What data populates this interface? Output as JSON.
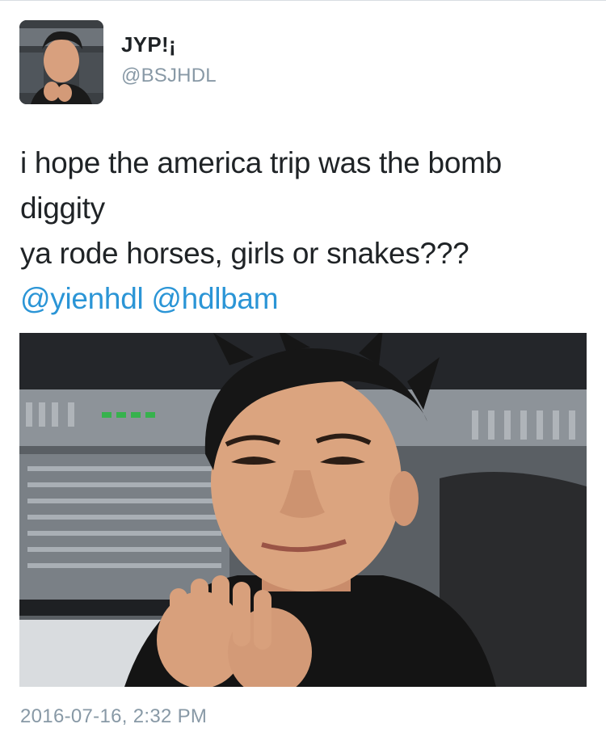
{
  "author": {
    "display_name": "JYP!¡",
    "handle": "@BSJHDL",
    "avatar": "avatar-photo"
  },
  "tweet": {
    "lines": [
      "i hope the america trip was the bomb",
      "diggity",
      "ya rode horses, girls or snakes???"
    ],
    "mentions": [
      "@yienhdl",
      "@hdlbam"
    ],
    "media": "attached-photo",
    "timestamp": "2016-07-16, 2:32 PM"
  },
  "colors": {
    "text": "#1f2326",
    "secondary": "#8899a6",
    "link": "#2b95d6",
    "divider": "#d8dde2"
  }
}
